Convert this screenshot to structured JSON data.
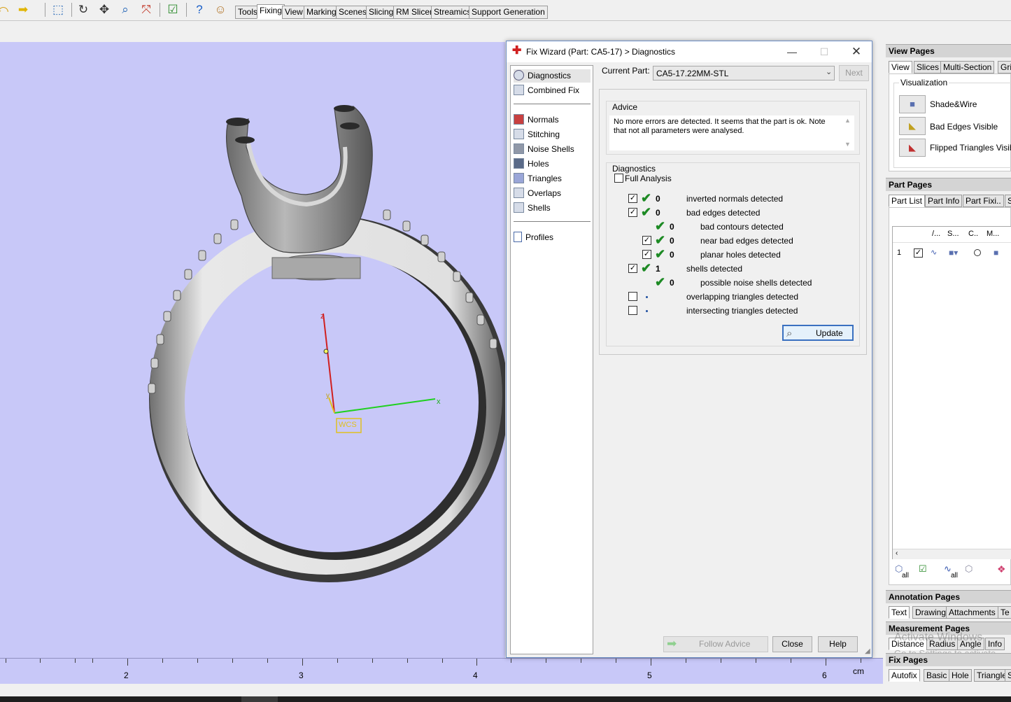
{
  "toolbar": {
    "tabs": [
      "Tools",
      "Fixing",
      "View",
      "Marking",
      "Scenes",
      "Slicing",
      "RM Slicer",
      "Streamics",
      "Support Generation"
    ],
    "active_tab": "Fixing"
  },
  "viewport": {
    "axis_z": "z",
    "axis_x": "x",
    "axis_y": "y",
    "wcs_label": "WCS",
    "background": "#c8c8f8"
  },
  "ruler": {
    "labels": [
      "2",
      "3",
      "4",
      "5",
      "6"
    ],
    "unit": "cm"
  },
  "dialog": {
    "title": "Fix Wizard (Part: CA5-17) > Diagnostics",
    "nav": {
      "diagnostics": "Diagnostics",
      "combined_fix": "Combined Fix",
      "normals": "Normals",
      "stitching": "Stitching",
      "noise_shells": "Noise Shells",
      "holes": "Holes",
      "triangles": "Triangles",
      "overlaps": "Overlaps",
      "shells": "Shells",
      "profiles": "Profiles"
    },
    "current_part_label": "Current Part:",
    "current_part_value": "CA5-17.22MM-STL",
    "next_label": "Next",
    "advice_label": "Advice",
    "advice_line1": "No more errors are detected. It seems that the part is ok. Note",
    "advice_line2": "that not all parameters were analysed.",
    "diagnostics_label": "Diagnostics",
    "full_analysis_label": "Full Analysis",
    "rows": [
      {
        "count": "0",
        "text": "inverted normals detected"
      },
      {
        "count": "0",
        "text": "bad edges detected"
      },
      {
        "count": "0",
        "text": "bad contours detected"
      },
      {
        "count": "0",
        "text": "near bad edges detected"
      },
      {
        "count": "0",
        "text": "planar holes detected"
      },
      {
        "count": "1",
        "text": "shells detected"
      },
      {
        "count": "0",
        "text": "possible noise shells detected"
      },
      {
        "count": "",
        "text": "overlapping triangles detected"
      },
      {
        "count": "",
        "text": "intersecting triangles detected"
      }
    ],
    "update_label": "Update",
    "follow_advice_label": "Follow Advice",
    "close_label": "Close",
    "help_label": "Help"
  },
  "rpanel": {
    "view_pages": "View Pages",
    "view_tabs": [
      "View",
      "Slices",
      "Multi-Section",
      "Grid"
    ],
    "visualization": "Visualization",
    "vis_items": [
      "Shade&Wire",
      "Bad Edges Visible",
      "Flipped Triangles Visible"
    ],
    "part_pages": "Part Pages",
    "part_tabs": [
      "Part List",
      "Part Info",
      "Part Fixi..",
      "S"
    ],
    "part_cols": [
      "/...",
      "S...",
      "C..",
      "M..."
    ],
    "part_row_index": "1",
    "all_label": "all",
    "annotation_pages": "Annotation Pages",
    "annotation_tabs": [
      "Text",
      "Drawing",
      "Attachments",
      "Te"
    ],
    "measurement_pages": "Measurement Pages",
    "measurement_tabs": [
      "Distance",
      "Radius",
      "Angle",
      "Info"
    ],
    "fix_pages": "Fix Pages",
    "fix_tabs": [
      "Autofix",
      "Basic",
      "Hole",
      "Triangle",
      "S"
    ],
    "watermark1": "Activate Windows",
    "watermark2": "Go to Settings to activate"
  }
}
